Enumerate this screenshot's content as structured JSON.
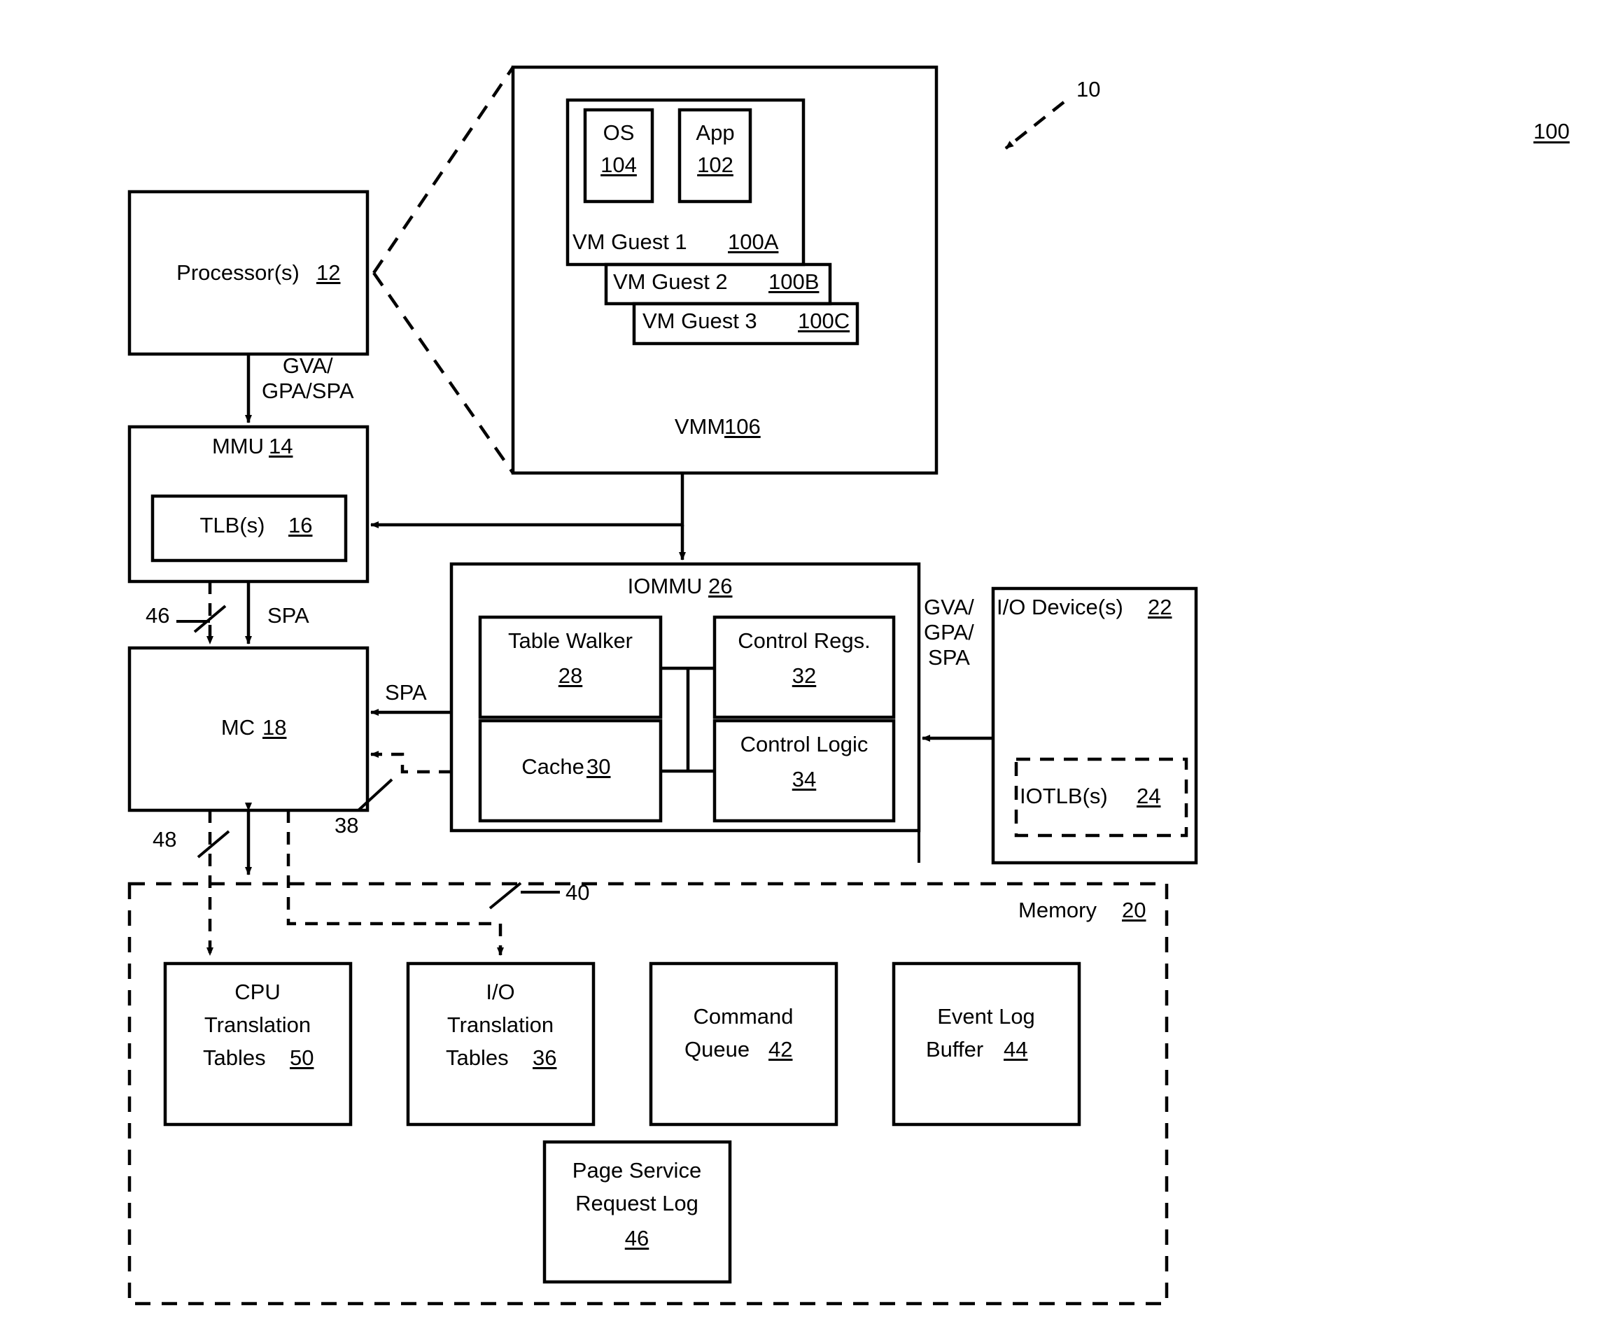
{
  "figure": {
    "figure_ref": "100",
    "system_ref": "10"
  },
  "vmm_panel": {
    "title": "VMM 106",
    "title_text": "VMM",
    "title_num": "106",
    "guests": [
      {
        "label": "VM Guest 1",
        "num": "100A"
      },
      {
        "label": "VM Guest 2",
        "num": "100B"
      },
      {
        "label": "VM Guest 3",
        "num": "100C"
      }
    ],
    "os_box": {
      "label": "OS",
      "num": "104"
    },
    "app_box": {
      "label": "App",
      "num": "102"
    }
  },
  "cpu_path": {
    "processor": {
      "label": "Processor(s)",
      "num": "12"
    },
    "mmu": {
      "label": "MMU",
      "num": "14"
    },
    "tlb": {
      "label": "TLB(s)",
      "num": "16"
    },
    "mc": {
      "label": "MC",
      "num": "18"
    },
    "edge_proc_to_mmu": "GVA/\nGPA/SPA",
    "edge_mmu_to_mc": "SPA",
    "ref_46": "46",
    "ref_48": "48"
  },
  "iommu": {
    "title": "IOMMU",
    "num": "26",
    "blocks": [
      {
        "label": "Table Walker",
        "num": "28"
      },
      {
        "label": "Control Regs.",
        "num": "32"
      },
      {
        "label": "Cache",
        "num": "30"
      },
      {
        "label": "Control Logic",
        "num": "34"
      }
    ],
    "edge_to_mc": "SPA",
    "ref_38": "38",
    "ref_40": "40"
  },
  "io_device": {
    "label": "I/O Device(s)",
    "num": "22",
    "iotlb": {
      "label": "IOTLB(s)",
      "num": "24"
    },
    "edge_label": "GVA/\nGPA/\nSPA"
  },
  "memory": {
    "title": "Memory",
    "num": "20",
    "blocks": [
      {
        "line1": "CPU",
        "line2": "Translation",
        "line3": "Tables",
        "num": "50"
      },
      {
        "line1": "I/O",
        "line2": "Translation",
        "line3": "Tables",
        "num": "36"
      },
      {
        "line1": "Command",
        "line2": "Queue",
        "num": "42"
      },
      {
        "line1": "Event Log",
        "line2": "Buffer",
        "num": "44"
      },
      {
        "line1": "Page Service",
        "line2": "Request Log",
        "num": "46"
      }
    ]
  }
}
